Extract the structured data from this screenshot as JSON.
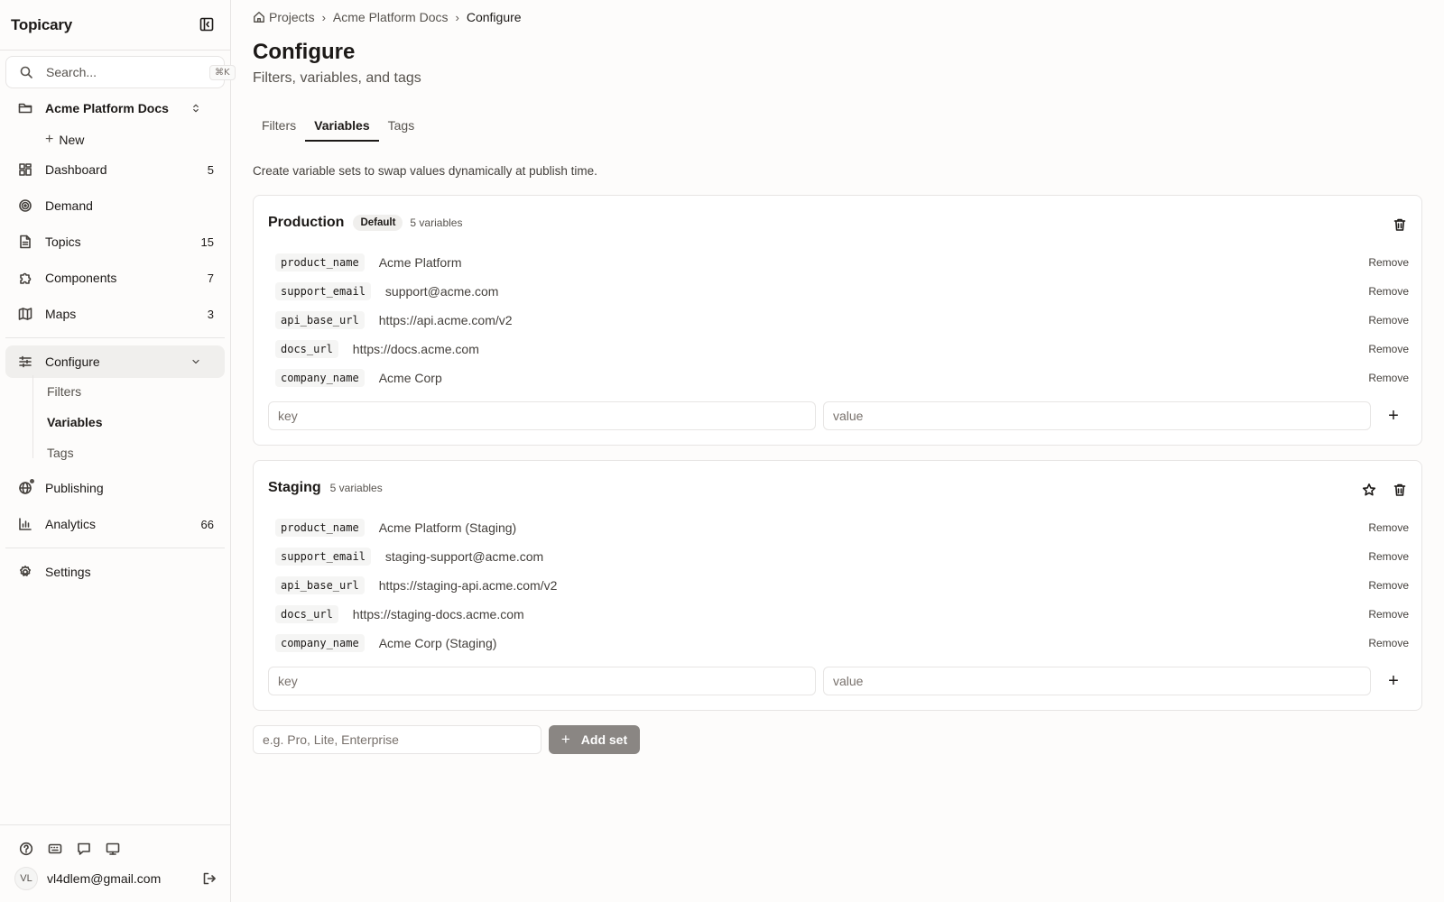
{
  "sidebar": {
    "brand": "Topicary",
    "search_placeholder": "Search...",
    "search_shortcut": "⌘K",
    "project": "Acme Platform Docs",
    "new_label": "New",
    "nav": [
      {
        "label": "Dashboard",
        "count": "5",
        "icon": "dashboard-icon"
      },
      {
        "label": "Demand",
        "count": "",
        "icon": "target-icon"
      },
      {
        "label": "Topics",
        "count": "15",
        "icon": "document-icon"
      },
      {
        "label": "Components",
        "count": "7",
        "icon": "puzzle-icon"
      },
      {
        "label": "Maps",
        "count": "3",
        "icon": "map-icon"
      }
    ],
    "configure": {
      "label": "Configure",
      "children": [
        "Filters",
        "Variables",
        "Tags"
      ],
      "active_child": "Variables"
    },
    "nav2": [
      {
        "label": "Publishing",
        "count": "",
        "icon": "globe-icon"
      },
      {
        "label": "Analytics",
        "count": "66",
        "icon": "bar-chart-icon"
      }
    ],
    "settings_label": "Settings",
    "user": {
      "initials": "VL",
      "email": "vl4dlem@gmail.com"
    }
  },
  "breadcrumb": [
    "Projects",
    "Acme Platform Docs",
    "Configure"
  ],
  "page": {
    "title": "Configure",
    "subtitle": "Filters, variables, and tags",
    "tabs": [
      "Filters",
      "Variables",
      "Tags"
    ],
    "active_tab": "Variables",
    "description": "Create variable sets to swap values dynamically at publish time."
  },
  "sets": [
    {
      "name": "Production",
      "badge": "Default",
      "count_label": "5 variables",
      "variables": [
        {
          "key": "product_name",
          "value": "Acme Platform"
        },
        {
          "key": "support_email",
          "value": "support@acme.com"
        },
        {
          "key": "api_base_url",
          "value": "https://api.acme.com/v2"
        },
        {
          "key": "docs_url",
          "value": "https://docs.acme.com"
        },
        {
          "key": "company_name",
          "value": "Acme Corp"
        }
      ]
    },
    {
      "name": "Staging",
      "badge": "",
      "count_label": "5 variables",
      "variables": [
        {
          "key": "product_name",
          "value": "Acme Platform (Staging)"
        },
        {
          "key": "support_email",
          "value": "staging-support@acme.com"
        },
        {
          "key": "api_base_url",
          "value": "https://staging-api.acme.com/v2"
        },
        {
          "key": "docs_url",
          "value": "https://staging-docs.acme.com"
        },
        {
          "key": "company_name",
          "value": "Acme Corp (Staging)"
        }
      ]
    }
  ],
  "labels": {
    "remove": "Remove",
    "key_placeholder": "key",
    "value_placeholder": "value",
    "new_set_placeholder": "e.g. Pro, Lite, Enterprise",
    "add_set": "Add set"
  }
}
